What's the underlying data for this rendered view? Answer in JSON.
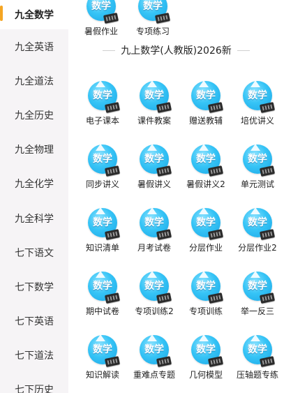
{
  "sidebar": {
    "items": [
      {
        "label": "九全数学",
        "active": true
      },
      {
        "label": "九全英语"
      },
      {
        "label": "九全道法"
      },
      {
        "label": "九全历史"
      },
      {
        "label": "九全物理"
      },
      {
        "label": "九全化学"
      },
      {
        "label": "九全科学"
      },
      {
        "label": "七下语文"
      },
      {
        "label": "七下数学"
      },
      {
        "label": "七下英语"
      },
      {
        "label": "七下道法"
      },
      {
        "label": "七下历史"
      }
    ]
  },
  "top_row": [
    {
      "label": "暑假作业"
    },
    {
      "label": "专项练习"
    }
  ],
  "section": {
    "title": "九上数学(人教版)2026新"
  },
  "icon_word": "数学",
  "tiles": [
    {
      "label": "电子课本"
    },
    {
      "label": "课件教案"
    },
    {
      "label": "赠送教辅"
    },
    {
      "label": "培优讲义"
    },
    {
      "label": "同步讲义"
    },
    {
      "label": "暑假讲义"
    },
    {
      "label": "暑假讲义2"
    },
    {
      "label": "单元测试"
    },
    {
      "label": "知识清单"
    },
    {
      "label": "月考试卷"
    },
    {
      "label": "分层作业"
    },
    {
      "label": "分层作业2"
    },
    {
      "label": "期中试卷"
    },
    {
      "label": "专项训练2"
    },
    {
      "label": "专项训练"
    },
    {
      "label": "举一反三"
    },
    {
      "label": "知识解读"
    },
    {
      "label": "重难点专题"
    },
    {
      "label": "几何模型"
    },
    {
      "label": "压轴题专练"
    }
  ],
  "colors": {
    "accent": "#f5a623",
    "icon_blue": "#36c4f6",
    "sidebar_bg": "#f6f4f6"
  }
}
